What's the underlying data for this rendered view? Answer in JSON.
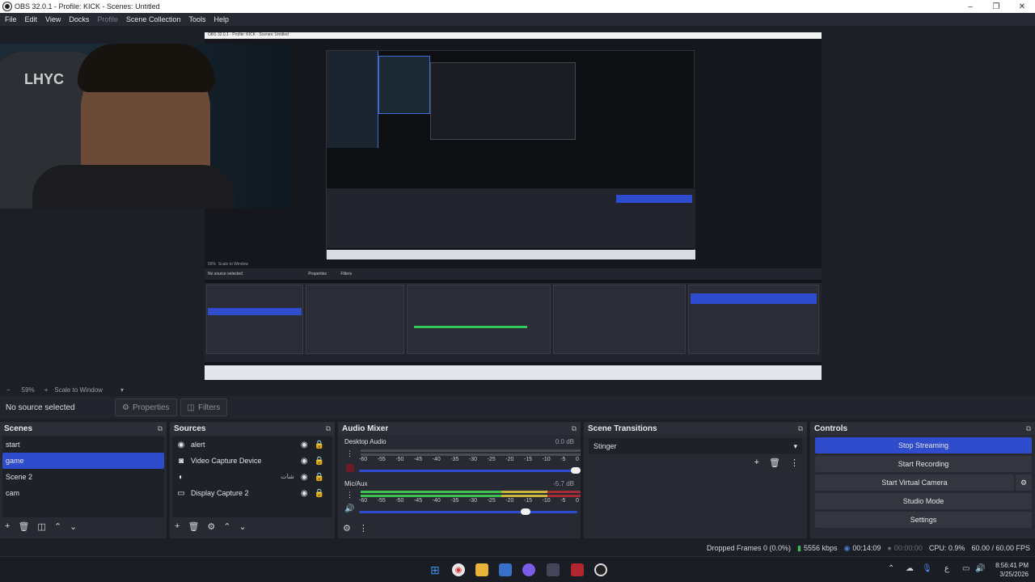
{
  "window": {
    "title": "OBS 32.0.1 - Profile: KICK - Scenes: Untitled",
    "minimize": "–",
    "maximize": "❐",
    "close": "✕"
  },
  "menu": [
    "File",
    "Edit",
    "View",
    "Docks",
    "Profile",
    "Scene Collection",
    "Tools",
    "Help"
  ],
  "preview": {
    "webcam_text": "LHYC",
    "nested": {
      "title": "OBS 32.0.1 - Profile: KICK - Scenes: Untitled",
      "zoom": "59%",
      "scale": "Scale to Window",
      "no_source": "No source selected",
      "properties": "Properties",
      "filters": "Filters"
    }
  },
  "zoombar": {
    "minus": "−",
    "zoom": "59%",
    "plus": "+",
    "scale": "Scale to Window"
  },
  "propbar": {
    "no_source": "No source selected",
    "properties": "Properties",
    "filters": "Filters"
  },
  "scenes": {
    "title": "Scenes",
    "items": [
      "start",
      "game",
      "Scene 2",
      "cam"
    ],
    "selected": "game"
  },
  "sources": {
    "title": "Sources",
    "items": [
      {
        "icon": "alert-source-icon",
        "label": "alert",
        "rtl": ""
      },
      {
        "icon": "camera-icon",
        "label": "Video Capture Device",
        "rtl": ""
      },
      {
        "icon": "browser-icon",
        "label": "",
        "rtl": "شات"
      },
      {
        "icon": "monitor-icon",
        "label": "Display Capture 2",
        "rtl": ""
      }
    ]
  },
  "audio": {
    "title": "Audio Mixer",
    "channels": [
      {
        "name": "Desktop Audio",
        "db": "0.0 dB",
        "level": 0.0,
        "volume": 1.0
      },
      {
        "name": "Mic/Aux",
        "db": "-5.7 dB",
        "level": 0.88,
        "volume": 0.76
      }
    ],
    "scale": [
      "-60",
      "-55",
      "-50",
      "-45",
      "-40",
      "-35",
      "-30",
      "-25",
      "-20",
      "-15",
      "-10",
      "-5",
      "0"
    ]
  },
  "transitions": {
    "title": "Scene Transitions",
    "selected": "Stinger"
  },
  "controls": {
    "title": "Controls",
    "buttons": [
      "Stop Streaming",
      "Start Recording",
      "Start Virtual Camera",
      "Studio Mode",
      "Settings"
    ]
  },
  "status": {
    "dropped": "Dropped Frames 0 (0.0%)",
    "kbps": "5556 kbps",
    "stream_time": "00:14:09",
    "rec_time": "00:00:00",
    "cpu": "CPU: 0.9%",
    "fps": "60.00 / 60.00 FPS"
  },
  "taskbar": {
    "time": "8:56:41 PM",
    "date": "3/25/2026",
    "lang": "ع"
  },
  "colors": {
    "accent": "#2f4ccc",
    "panel": "#272a33",
    "bg": "#1d1f26"
  }
}
